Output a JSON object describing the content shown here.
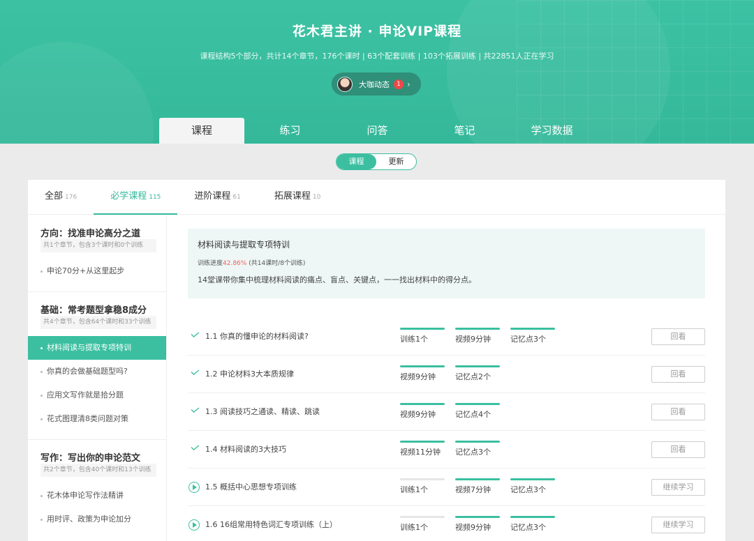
{
  "header": {
    "title": "花木君主讲 · 申论VIP课程",
    "subtitle": "课程结构5个部分，共计14个章节，176个课时 | 63个配套训练 | 103个拓展训练 | 共22851人正在学习",
    "daka_label": "大咖动态",
    "daka_badge": "1",
    "tabs": [
      "课程",
      "练习",
      "问答",
      "笔记",
      "学习数据"
    ]
  },
  "toggle": {
    "left": "课程",
    "right": "更新"
  },
  "category_tabs": [
    {
      "label": "全部",
      "count": "176"
    },
    {
      "label": "必学课程",
      "count": "115"
    },
    {
      "label": "进阶课程",
      "count": "61"
    },
    {
      "label": "拓展课程",
      "count": "10"
    }
  ],
  "sidebar": {
    "sections": [
      {
        "title": "方向：找准申论高分之道",
        "meta": "共1个章节，包含3个课时和0个训练",
        "items": [
          "申论70分+从这里起步"
        ]
      },
      {
        "title": "基础：常考题型拿稳8成分",
        "meta": "共4个章节，包含64个课时和33个训练",
        "items": [
          "材料阅读与提取专项特训",
          "你真的会做基础题型吗?",
          "应用文写作就是拾分题",
          "花式图理清8类问题对策"
        ]
      },
      {
        "title": "写作：写出你的申论范文",
        "meta": "共2个章节，包含40个课时和13个训练",
        "items": [
          "花木体申论写作法精讲",
          "用时评、政策为申论加分"
        ]
      }
    ]
  },
  "info": {
    "title": "材料阅读与提取专项特训",
    "progress_prefix": "训练进度",
    "progress_pct": "42.86%",
    "progress_suffix": " (共14课时/8个训练)",
    "desc": "14堂课带你集中梳理材料阅读的痛点、盲点、关键点，一一找出材料中的得分点。"
  },
  "lessons": [
    {
      "title": "1.1 你真的懂申论的材料阅读?",
      "tags": [
        "训练1个",
        "视频9分钟",
        "记忆点3个"
      ],
      "button": "回看"
    },
    {
      "title": "1.2 申论材料3大本质规律",
      "tags": [
        "视频9分钟",
        "记忆点2个"
      ],
      "button": "回看"
    },
    {
      "title": "1.3 阅读技巧之通读、精读、跳读",
      "tags": [
        "视频9分钟",
        "记忆点4个"
      ],
      "button": "回看"
    },
    {
      "title": "1.4 材料阅读的3大技巧",
      "tags": [
        "视频11分钟",
        "记忆点3个"
      ],
      "button": "回看"
    },
    {
      "title": "1.5 概括中心思想专项训练",
      "tags": [
        "训练1个",
        "视频7分钟",
        "记忆点3个"
      ],
      "button": "继续学习"
    },
    {
      "title": "1.6 16组常用特色词汇专项训练（上）",
      "tags": [
        "训练1个",
        "视频9分钟",
        "记忆点3个"
      ],
      "button": "继续学习"
    }
  ],
  "colors": {
    "accent": "#3bbfa0",
    "header_bg": "#3cc2a3",
    "progress_red": "#f06060"
  }
}
